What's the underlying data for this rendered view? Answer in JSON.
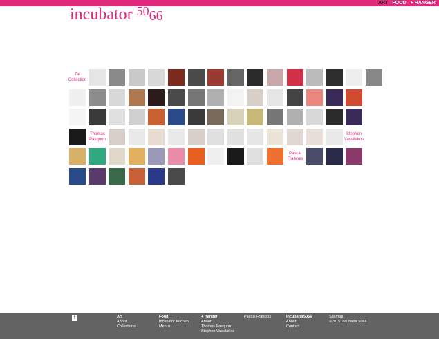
{
  "header": {
    "logo_text": "incubator",
    "logo_num_a": "50",
    "logo_num_b": "66",
    "brand_color": "#e2287c",
    "nav": {
      "art": "ART",
      "food": "FOOD",
      "hanger": "+ HANGER"
    }
  },
  "grid": {
    "labels": {
      "tie": "Tie Collection",
      "thomas": "Thomas Pasquon",
      "stephen": "Stephen Vassilakos",
      "pascal": "Pascal François"
    },
    "rows": [
      [
        "label:tie",
        "#e6e6e6",
        "#8a8a8a",
        "#c9c9c9",
        "#d8d8d8",
        "#7a2a1e",
        "#4a4a4a",
        "#9a3a30",
        "#666666",
        "#2b2b2b",
        "#c8a8a8",
        "#d23048",
        "#bbbbbb",
        "#2e2e2e",
        "#eeeeee",
        "#888888"
      ],
      [
        "#f0f0f0",
        "#8c8c8c",
        "#d8d8d8",
        "#b07850",
        "#2a1a1a",
        "#4a4a4a",
        "#777777",
        "#b0b0b0",
        "#f3f3f3",
        "#d8d0c8",
        "#e6e6e6",
        "#444444",
        "#ea8880",
        "#3a2a5a",
        "#d04a30"
      ],
      [
        "#f5f5f5",
        "#3a3a3a",
        "#e0e0e0",
        "#d0d0d0",
        "#c86030",
        "#2a4a8a",
        "#3a3a3a",
        "#7a6a5a",
        "#d8d2b8",
        "#c8b878",
        "#777777",
        "#b0b0b0",
        "#d8d8d8",
        "#2a2a2a",
        "#3a2a5a"
      ],
      [
        "#1a1a1a",
        "label:thomas",
        "#d8d0c8",
        "#e8e8e8",
        "#e6dcd2",
        "#e8e8e8",
        "#d8d0c8",
        "#e0e0e0",
        "#e0e0e0",
        "#e6e6e6",
        "#ece4d8",
        "#e0d8d0",
        "#e8e0d8",
        "#e8e8e8",
        "label:stephen"
      ],
      [
        "#d8b068",
        "#30a880",
        "#e0d8c8",
        "#e0b060",
        "#9a9ab8",
        "#e88ca8",
        "#e86020",
        "#f0f0f0",
        "#1a1a1a",
        "#e0e0e0",
        "#ee7030",
        "label:pascal",
        "#4a4a6a",
        "#2a2a4a",
        "#8a3a6a"
      ],
      [
        "#2a4a8a",
        "#5a3a6a",
        "#3a6a4a",
        "#c8603a",
        "#2a3a8a",
        "#4a4a4a"
      ]
    ]
  },
  "footer": {
    "facebook_icon": "f",
    "art": {
      "heading": "Art",
      "links": [
        "About",
        "Collections"
      ]
    },
    "food": {
      "heading": "Food",
      "links": [
        "Incubator Kitchen",
        "Menus"
      ]
    },
    "hanger": {
      "heading": "+ Hanger",
      "links": [
        "About",
        "Thomas Pasquon",
        "Stephen Vassilakos"
      ]
    },
    "pascal": {
      "heading": "Pascal François"
    },
    "incubator": {
      "heading": "Incubator5066",
      "links": [
        "About",
        "Contact"
      ]
    },
    "site": {
      "sitemap": "Sitemap",
      "copyright": "©2015 Incubator 5066"
    }
  }
}
